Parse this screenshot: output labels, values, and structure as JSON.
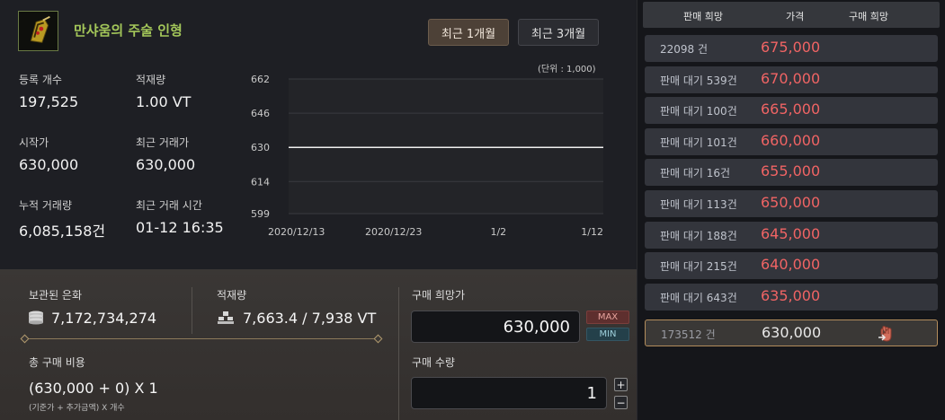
{
  "item": {
    "name": "만샤움의 주술 인형",
    "icon": "cursed-doll-icon"
  },
  "period_buttons": [
    "최근 1개월",
    "최근 3개월"
  ],
  "stats": {
    "registered_label": "등록 개수",
    "registered_value": "197,525",
    "weight_label": "적재량",
    "weight_value": "1.00 VT",
    "start_price_label": "시작가",
    "start_price_value": "630,000",
    "recent_trade_label": "최근 거래가",
    "recent_trade_value": "630,000",
    "total_volume_label": "누적 거래량",
    "total_volume_value": "6,085,158건",
    "recent_time_label": "최근 거래 시간",
    "recent_time_value": "01-12 16:35"
  },
  "chart_data": {
    "type": "line",
    "unit_label": "(단위 : 1,000)",
    "x_tick_labels": [
      "2020/12/13",
      "2020/12/23",
      "1/2",
      "1/12"
    ],
    "y_tick_labels": [
      "662",
      "646",
      "630",
      "614",
      "599"
    ],
    "ylim": [
      599,
      662
    ],
    "grid": true,
    "series": [
      {
        "x": [
          "2020/12/13",
          "2020/12/23",
          "1/2",
          "1/12"
        ],
        "values": [
          630,
          630,
          630,
          630
        ]
      }
    ]
  },
  "bottom": {
    "silver_label": "보관된 은화",
    "silver_value": "7,172,734,274",
    "silver_icon": "coin-stack-icon",
    "weight_label": "적재량",
    "weight_value": "7,663.4 / 7,938 VT",
    "weight_icon": "weight-icon",
    "total_cost_label": "총 구매 비용",
    "total_cost_value": "(630,000 + 0) X 1",
    "total_cost_note": "(기준가 + 추가금액) X 개수",
    "desired_price_label": "구매 희망가",
    "desired_price_value": "630,000",
    "max_label": "MAX",
    "min_label": "MIN",
    "quantity_label": "구매 수량",
    "quantity_value": "1",
    "plus_label": "+",
    "minus_label": "−"
  },
  "orderbook": {
    "headers": [
      "판매 희망",
      "가격",
      "구매 희망"
    ],
    "rows": [
      {
        "qty": "22098 건",
        "price": "675,000"
      },
      {
        "qty": "판매 대기 539건",
        "price": "670,000"
      },
      {
        "qty": "판매 대기 100건",
        "price": "665,000"
      },
      {
        "qty": "판매 대기 101건",
        "price": "660,000"
      },
      {
        "qty": "판매 대기 16건",
        "price": "655,000"
      },
      {
        "qty": "판매 대기 113건",
        "price": "650,000"
      },
      {
        "qty": "판매 대기 188건",
        "price": "645,000"
      },
      {
        "qty": "판매 대기 215건",
        "price": "640,000"
      },
      {
        "qty": "판매 대기 643건",
        "price": "635,000"
      }
    ],
    "last_row": {
      "qty": "173512 건",
      "price": "630,000",
      "icon": "buy-hand-icon"
    },
    "colors": {
      "sell_price": "#f06464",
      "highlight_border": "#b38d5c"
    }
  }
}
